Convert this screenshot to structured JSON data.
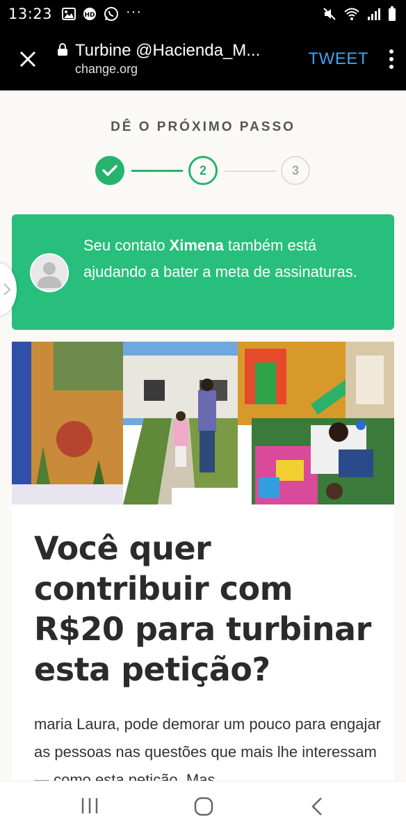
{
  "status_bar": {
    "time": "13:23",
    "dots": "···",
    "icons_left": [
      "image-icon",
      "hd-icon",
      "whatsapp-icon"
    ],
    "icons_right": [
      "mute-icon",
      "wifi-icon",
      "signal-icon",
      "battery-icon"
    ]
  },
  "toolbar": {
    "title": "Turbine @Hacienda_M...",
    "domain": "change.org",
    "tweet_label": "TWEET",
    "bg_color": "#000000",
    "accent_color": "#3ea3f2"
  },
  "stepper": {
    "heading": "DÊ O PRÓXIMO PASSO",
    "steps": [
      {
        "label": "",
        "state": "done"
      },
      {
        "label": "2",
        "state": "current"
      },
      {
        "label": "3",
        "state": "upcoming"
      }
    ],
    "color": "#26b36d"
  },
  "notice": {
    "prefix": "Seu contato ",
    "name": "Ximena",
    "suffix": " também está ajudando a bater a meta de assinaturas.",
    "bg_color": "#27bf7b"
  },
  "card": {
    "headline": "Você quer contribuir com R$20 para turbinar esta petição?",
    "body": "maria Laura, pode demorar um pouco para engajar as pessoas nas questões que mais lhe interessam — como esta petição. Mas"
  },
  "nav_bar": {
    "buttons": [
      "recents-icon",
      "home-icon",
      "back-icon"
    ]
  }
}
